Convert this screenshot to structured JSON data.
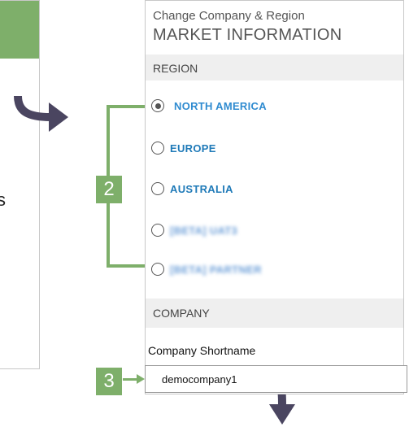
{
  "panel": {
    "subtitle": "Change Company & Region",
    "title": "MARKET INFORMATION"
  },
  "left_panel": {
    "partial_text": "s"
  },
  "region": {
    "section_label": "REGION",
    "options": [
      {
        "label": "NORTH AMERICA",
        "selected": true
      },
      {
        "label": "EUROPE",
        "selected": false
      },
      {
        "label": "AUSTRALIA",
        "selected": false
      },
      {
        "label": "[BETA] UAT3",
        "selected": false,
        "blurred": true
      },
      {
        "label": "[BETA] PARTNER",
        "selected": false,
        "blurred": true
      }
    ]
  },
  "company": {
    "section_label": "COMPANY",
    "shortname_label": "Company Shortname",
    "shortname_value": "democompany1"
  },
  "callouts": {
    "step2": "2",
    "step3": "3"
  },
  "colors": {
    "accent_green": "#7eaf6a",
    "arrow_dark": "#4a4560",
    "link_blue": "#1f7ab8"
  }
}
